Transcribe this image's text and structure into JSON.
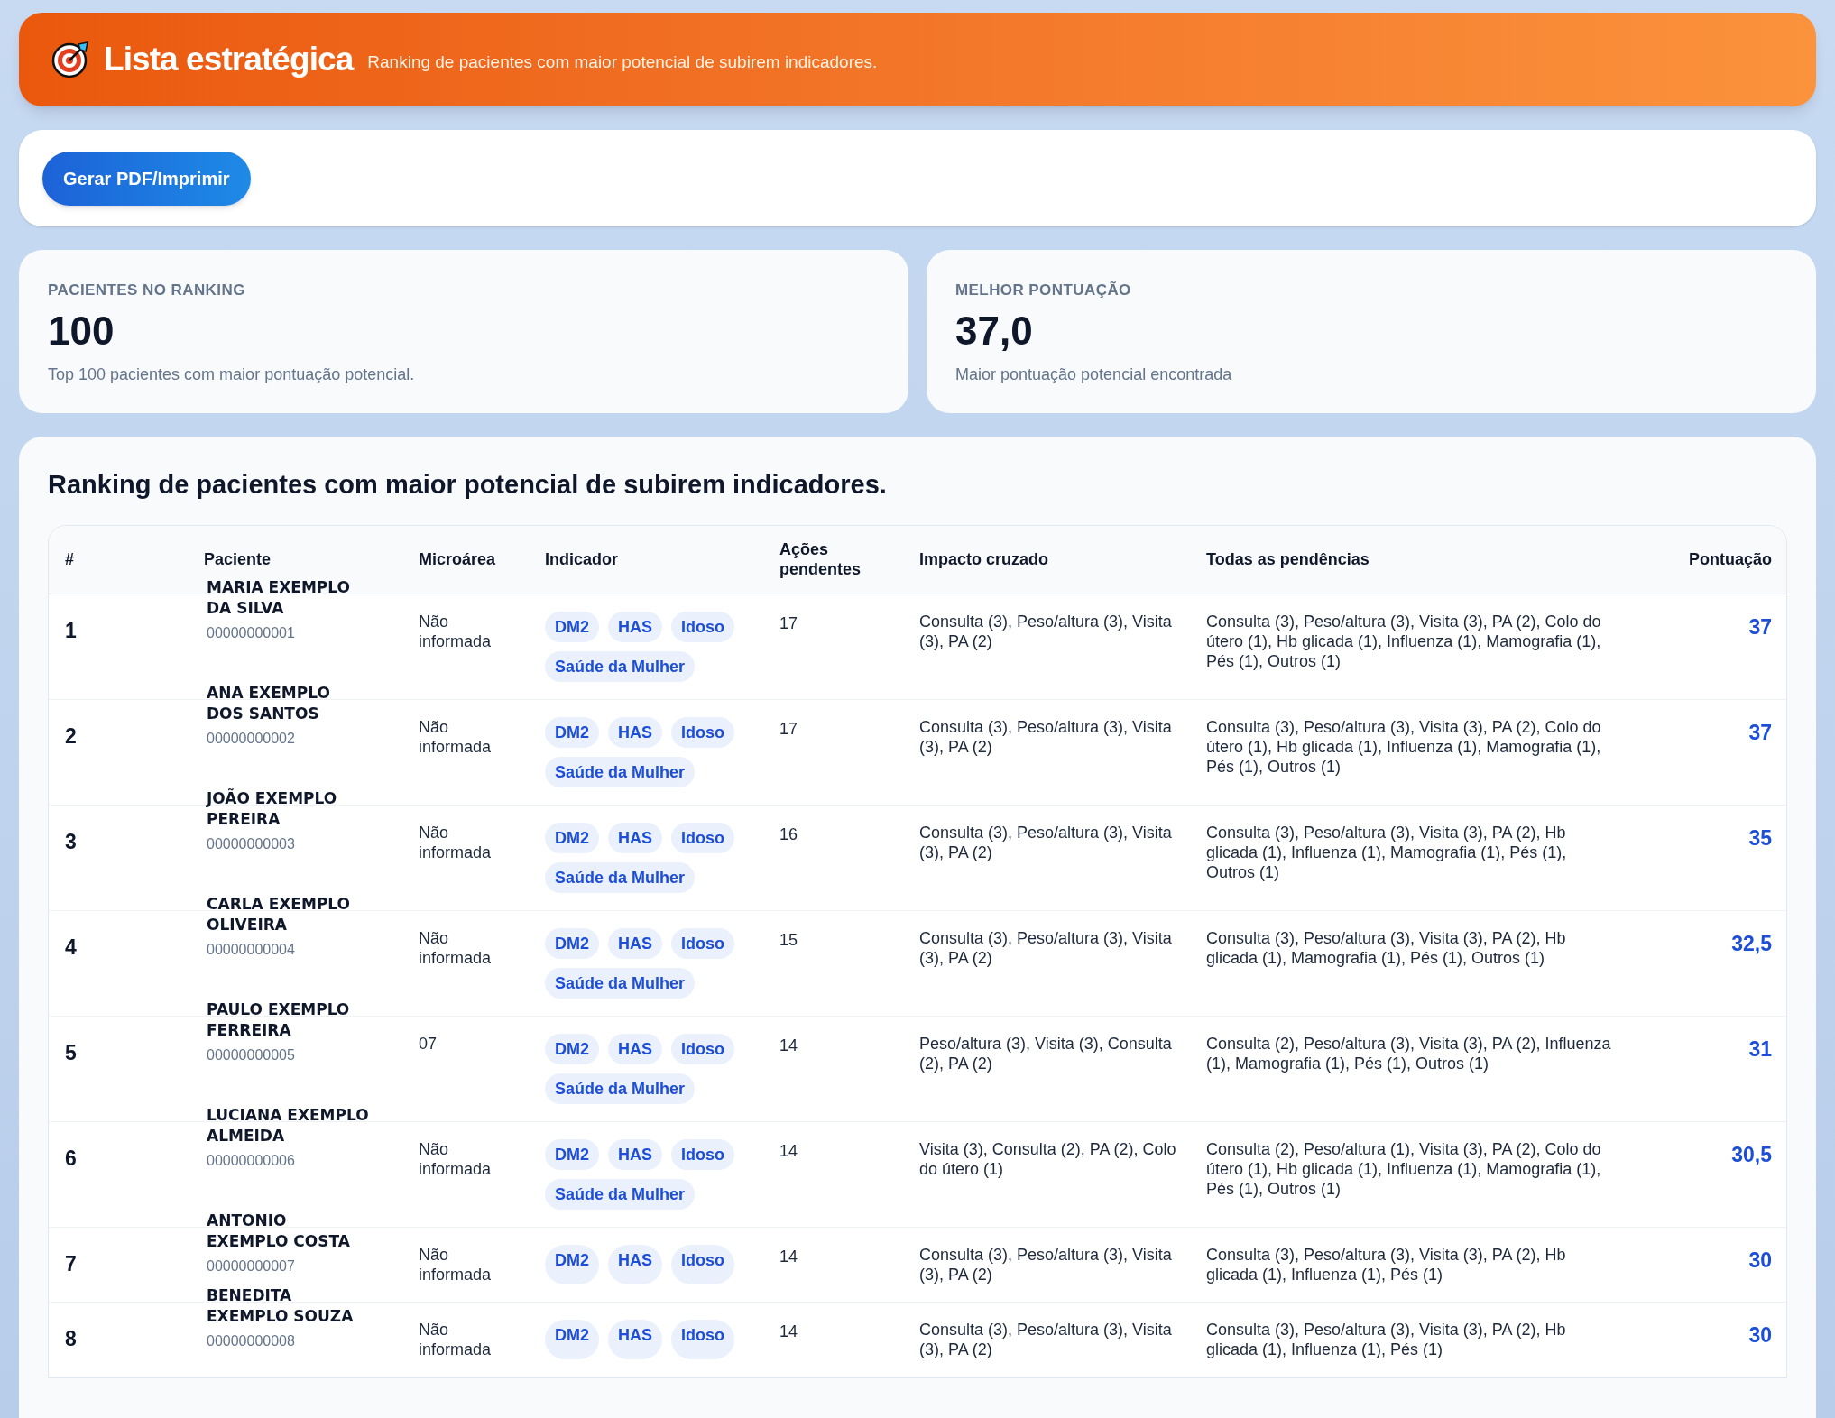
{
  "header": {
    "title": "Lista estratégica",
    "subtitle": "Ranking de pacientes com maior potencial de subirem indicadores."
  },
  "toolbar": {
    "button": "Gerar PDF/Imprimir"
  },
  "stats": [
    {
      "label": "PACIENTES NO RANKING",
      "value": "100",
      "note": "Top 100 pacientes com maior pontuação potencial."
    },
    {
      "label": "MELHOR PONTUAÇÃO",
      "value": "37,0",
      "note": "Maior pontuação potencial encontrada"
    }
  ],
  "table": {
    "title": "Ranking de pacientes com maior potencial de subirem indicadores.",
    "columns": [
      "#",
      "Paciente",
      "Microárea",
      "Indicador",
      "Ações pendentes",
      "Impacto cruzado",
      "Todas as pendências",
      "Pontuação"
    ],
    "rows": [
      {
        "rank": "1",
        "name": "MARIA EXEMPLO DA SILVA",
        "id": "00000000001",
        "microarea": "Não informada",
        "tags": [
          "DM2",
          "HAS",
          "Idoso",
          "Saúde da Mulher"
        ],
        "actions": "17",
        "impact": "Consulta (3), Peso/altura (3), Visita (3), PA (2)",
        "pending": "Consulta (3), Peso/altura (3), Visita (3), PA (2), Colo do útero (1), Hb glicada (1), Influenza (1), Mamografia (1), Pés (1), Outros (1)",
        "score": "37"
      },
      {
        "rank": "2",
        "name": "ANA EXEMPLO DOS SANTOS",
        "id": "00000000002",
        "microarea": "Não informada",
        "tags": [
          "DM2",
          "HAS",
          "Idoso",
          "Saúde da Mulher"
        ],
        "actions": "17",
        "impact": "Consulta (3), Peso/altura (3), Visita (3), PA (2)",
        "pending": "Consulta (3), Peso/altura (3), Visita (3), PA (2), Colo do útero (1), Hb glicada (1), Influenza (1), Mamografia (1), Pés (1), Outros (1)",
        "score": "37"
      },
      {
        "rank": "3",
        "name": "JOÃO EXEMPLO PEREIRA",
        "id": "00000000003",
        "microarea": "Não informada",
        "tags": [
          "DM2",
          "HAS",
          "Idoso",
          "Saúde da Mulher"
        ],
        "actions": "16",
        "impact": "Consulta (3), Peso/altura (3), Visita (3), PA (2)",
        "pending": "Consulta (3), Peso/altura (3), Visita (3), PA (2), Hb glicada (1), Influenza (1), Mamografia (1), Pés (1), Outros (1)",
        "score": "35"
      },
      {
        "rank": "4",
        "name": "CARLA EXEMPLO OLIVEIRA",
        "id": "00000000004",
        "microarea": "Não informada",
        "tags": [
          "DM2",
          "HAS",
          "Idoso",
          "Saúde da Mulher"
        ],
        "actions": "15",
        "impact": "Consulta (3), Peso/altura (3), Visita (3), PA (2)",
        "pending": "Consulta (3), Peso/altura (3), Visita (3), PA (2), Hb glicada (1), Mamografia (1), Pés (1), Outros (1)",
        "score": "32,5"
      },
      {
        "rank": "5",
        "name": "PAULO EXEMPLO FERREIRA",
        "id": "00000000005",
        "microarea": "07",
        "tags": [
          "DM2",
          "HAS",
          "Idoso",
          "Saúde da Mulher"
        ],
        "actions": "14",
        "impact": "Peso/altura (3), Visita (3), Consulta (2), PA (2)",
        "pending": "Consulta (2), Peso/altura (3), Visita (3), PA (2), Influenza (1), Mamografia (1), Pés (1), Outros (1)",
        "score": "31"
      },
      {
        "rank": "6",
        "name": "LUCIANA EXEMPLO ALMEIDA",
        "id": "00000000006",
        "microarea": "Não informada",
        "tags": [
          "DM2",
          "HAS",
          "Idoso",
          "Saúde da Mulher"
        ],
        "actions": "14",
        "impact": "Visita (3), Consulta (2), PA (2), Colo do útero (1)",
        "pending": "Consulta (2), Peso/altura (1), Visita (3), PA (2), Colo do útero (1), Hb glicada (1), Influenza (1), Mamografia (1), Pés (1), Outros (1)",
        "score": "30,5"
      },
      {
        "rank": "7",
        "name": "ANTONIO EXEMPLO COSTA",
        "id": "00000000007",
        "microarea": "Não informada",
        "tags": [
          "DM2",
          "HAS",
          "Idoso"
        ],
        "actions": "14",
        "impact": "Consulta (3), Peso/altura (3), Visita (3), PA (2)",
        "pending": "Consulta (3), Peso/altura (3), Visita (3), PA (2), Hb glicada (1), Influenza (1), Pés (1)",
        "score": "30"
      },
      {
        "rank": "8",
        "name": "BENEDITA EXEMPLO SOUZA",
        "id": "00000000008",
        "microarea": "Não informada",
        "tags": [
          "DM2",
          "HAS",
          "Idoso"
        ],
        "actions": "14",
        "impact": "Consulta (3), Peso/altura (3), Visita (3), PA (2)",
        "pending": "Consulta (3), Peso/altura (3), Visita (3), PA (2), Hb glicada (1), Influenza (1), Pés (1)",
        "score": "30"
      }
    ]
  }
}
